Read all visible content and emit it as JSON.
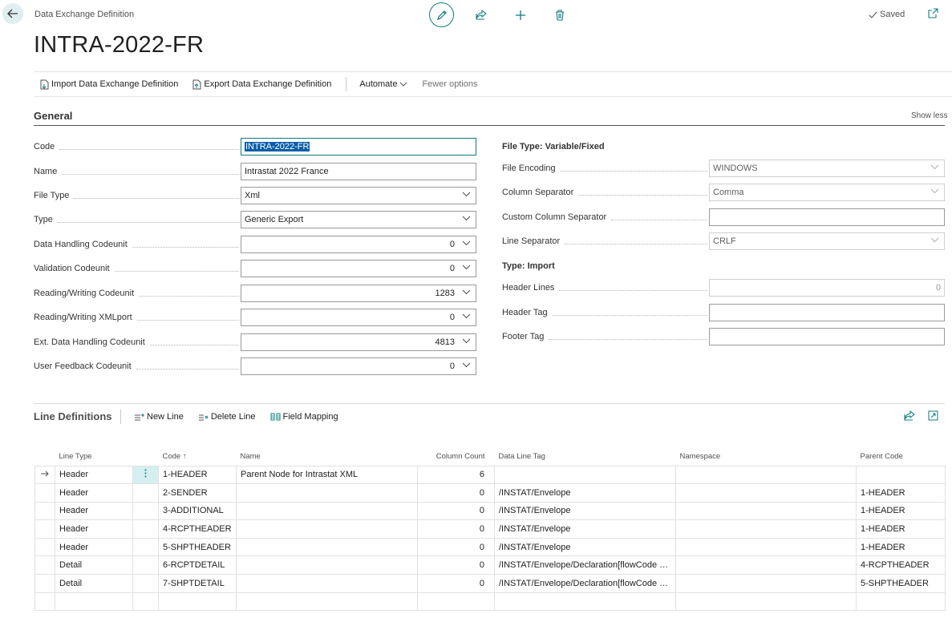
{
  "header": {
    "breadcrumb": "Data Exchange Definition",
    "title": "INTRA-2022-FR",
    "saved_label": "Saved"
  },
  "actions": {
    "import_label": "Import Data Exchange Definition",
    "export_label": "Export Data Exchange Definition",
    "automate_label": "Automate",
    "fewer_options_label": "Fewer options"
  },
  "general": {
    "title": "General",
    "show_less": "Show less",
    "left_fields": [
      {
        "label": "Code",
        "value": "INTRA-2022-FR"
      },
      {
        "label": "Name",
        "value": "Intrastat 2022 France"
      },
      {
        "label": "File Type",
        "value": "Xml"
      },
      {
        "label": "Type",
        "value": "Generic Export"
      },
      {
        "label": "Data Handling Codeunit",
        "value": "0"
      },
      {
        "label": "Validation Codeunit",
        "value": "0"
      },
      {
        "label": "Reading/Writing Codeunit",
        "value": "1283"
      },
      {
        "label": "Reading/Writing XMLport",
        "value": "0"
      },
      {
        "label": "Ext. Data Handling Codeunit",
        "value": "4813"
      },
      {
        "label": "User Feedback Codeunit",
        "value": "0"
      }
    ],
    "variable_group": "File Type: Variable/Fixed",
    "right_fields": [
      {
        "label": "File Encoding",
        "value": "WINDOWS"
      },
      {
        "label": "Column Separator",
        "value": "Comma"
      },
      {
        "label": "Custom Column Separator",
        "value": ""
      },
      {
        "label": "Line Separator",
        "value": "CRLF"
      }
    ],
    "import_group": "Type: Import",
    "import_fields": [
      {
        "label": "Header Lines",
        "value": "0"
      },
      {
        "label": "Header Tag",
        "value": ""
      },
      {
        "label": "Footer Tag",
        "value": ""
      }
    ]
  },
  "line_definitions": {
    "title": "Line Definitions",
    "new_line": "New Line",
    "delete_line": "Delete Line",
    "field_mapping": "Field Mapping",
    "columns": {
      "line_type": "Line Type",
      "code": "Code",
      "code_sort": "↑",
      "name": "Name",
      "column_count": "Column Count",
      "data_line_tag": "Data Line Tag",
      "namespace": "Namespace",
      "parent_code": "Parent Code"
    },
    "rows": [
      {
        "line_type": "Header",
        "code": "1-HEADER",
        "name": "Parent Node for Intrastat XML",
        "column_count": "6",
        "data_line_tag": "",
        "namespace": "",
        "parent_code": ""
      },
      {
        "line_type": "Header",
        "code": "2-SENDER",
        "name": "",
        "column_count": "0",
        "data_line_tag": "/INSTAT/Envelope",
        "namespace": "",
        "parent_code": "1-HEADER"
      },
      {
        "line_type": "Header",
        "code": "3-ADDITIONAL",
        "name": "",
        "column_count": "0",
        "data_line_tag": "/INSTAT/Envelope",
        "namespace": "",
        "parent_code": "1-HEADER"
      },
      {
        "line_type": "Header",
        "code": "4-RCPTHEADER",
        "name": "",
        "column_count": "0",
        "data_line_tag": "/INSTAT/Envelope",
        "namespace": "",
        "parent_code": "1-HEADER"
      },
      {
        "line_type": "Header",
        "code": "5-SHPTHEADER",
        "name": "",
        "column_count": "0",
        "data_line_tag": "/INSTAT/Envelope",
        "namespace": "",
        "parent_code": "1-HEADER"
      },
      {
        "line_type": "Detail",
        "code": "6-RCPTDETAIL",
        "name": "",
        "column_count": "0",
        "data_line_tag": "/INSTAT/Envelope/Declaration[flowCode =...",
        "namespace": "",
        "parent_code": "4-RCPTHEADER"
      },
      {
        "line_type": "Detail",
        "code": "7-SHPTDETAIL",
        "name": "",
        "column_count": "0",
        "data_line_tag": "/INSTAT/Envelope/Declaration[flowCode =...",
        "namespace": "",
        "parent_code": "5-SHPTHEADER"
      }
    ]
  },
  "colors": {
    "accent": "#107c7c",
    "selection": "#0a5ea8",
    "active_cell": "#d5eef0"
  }
}
